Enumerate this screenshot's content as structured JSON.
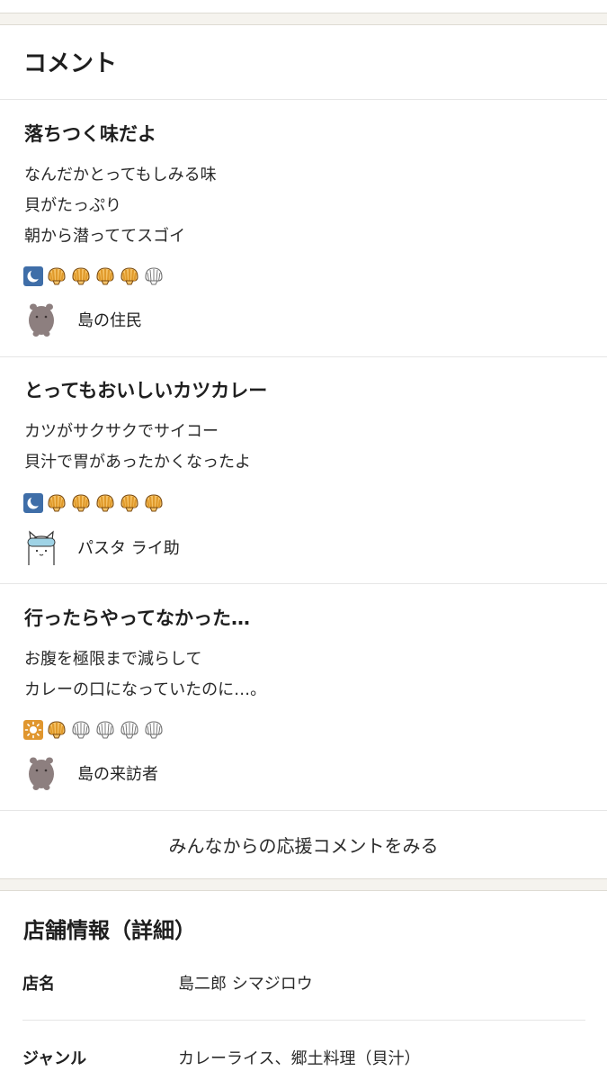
{
  "comments_section": {
    "title": "コメント",
    "items": [
      {
        "title": "落ちつく味だよ",
        "body": [
          "なんだかとってもしみる味",
          "貝がたっぷり",
          "朝から潜っててスゴイ"
        ],
        "time_icon": "moon-icon",
        "rating": 4,
        "rating_max": 5,
        "author": "島の住民",
        "avatar_icon": "hippo-avatar-icon"
      },
      {
        "title": "とってもおいしいカツカレー",
        "body": [
          "カツがサクサクでサイコー",
          "貝汁で胃があったかくなったよ"
        ],
        "time_icon": "moon-icon",
        "rating": 5,
        "rating_max": 5,
        "author": "パスタ ライ助",
        "avatar_icon": "cat-with-goggles-avatar-icon"
      },
      {
        "title": "行ったらやってなかった…",
        "body": [
          "お腹を極限まで減らして",
          "カレーの口になっていたのに…。"
        ],
        "time_icon": "sun-icon",
        "rating": 1,
        "rating_max": 5,
        "author": "島の来訪者",
        "avatar_icon": "hippo-avatar-icon"
      }
    ],
    "more_label": "みんなからの応援コメントをみる"
  },
  "store_info": {
    "title": "店舗情報（詳細）",
    "rows": [
      {
        "label": "店名",
        "value": "島二郎 シマジロウ"
      },
      {
        "label": "ジャンル",
        "value": "カレーライス、郷土料理（貝汁）"
      }
    ]
  },
  "colors": {
    "shell_filled": "#e09a2b",
    "shell_empty": "#d9d9d9",
    "moon_bg": "#3f6ea8",
    "sun_bg": "#e0962e",
    "band": "#f5f3ee"
  }
}
